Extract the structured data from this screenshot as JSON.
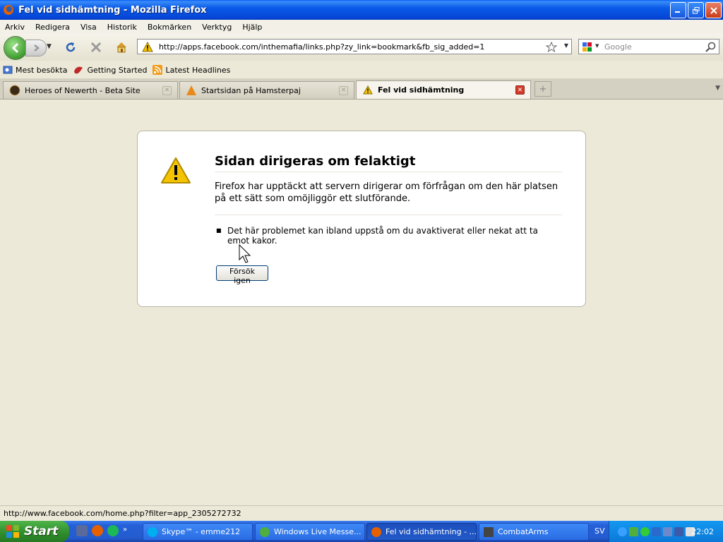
{
  "window": {
    "title": "Fel vid sidhämtning - Mozilla Firefox"
  },
  "menu": [
    "Arkiv",
    "Redigera",
    "Visa",
    "Historik",
    "Bokmärken",
    "Verktyg",
    "Hjälp"
  ],
  "navigation": {
    "url": "http://apps.facebook.com/inthemafia/links.php?zy_link=bookmark&fb_sig_added=1",
    "search_placeholder": "Google"
  },
  "bookmarks": [
    "Mest besökta",
    "Getting Started",
    "Latest Headlines"
  ],
  "tabs": [
    {
      "label": "Heroes of Newerth - Beta Site",
      "active": false
    },
    {
      "label": "Startsidan på Hamsterpaj",
      "active": false
    },
    {
      "label": "Fel vid sidhämtning",
      "active": true
    }
  ],
  "error_page": {
    "title": "Sidan dirigeras om felaktigt",
    "description": "Firefox har upptäckt att servern dirigerar om förfrågan om den här platsen på ett sätt som omöjliggör ett slutförande.",
    "bullets": [
      "Det här problemet kan ibland uppstå om du avaktiverat eller nekat att ta emot kakor."
    ],
    "retry_label": "Försök igen"
  },
  "status_bar": {
    "text": "http://www.facebook.com/home.php?filter=app_2305272732"
  },
  "taskbar": {
    "start_label": "Start",
    "tasks": [
      {
        "label": "Skype™ - emme212",
        "active": false
      },
      {
        "label": "Windows Live Messe...",
        "active": false
      },
      {
        "label": "Fel vid sidhämtning - ...",
        "active": true
      },
      {
        "label": "CombatArms",
        "active": false
      }
    ],
    "language": "SV",
    "clock": "22:02"
  },
  "colors": {
    "titlebar": "#0a5ae8",
    "taskbar": "#245cd0",
    "start_button": "#2f8b2b",
    "warning": "#f5c400",
    "active_tab_close": "#d23a2a"
  }
}
